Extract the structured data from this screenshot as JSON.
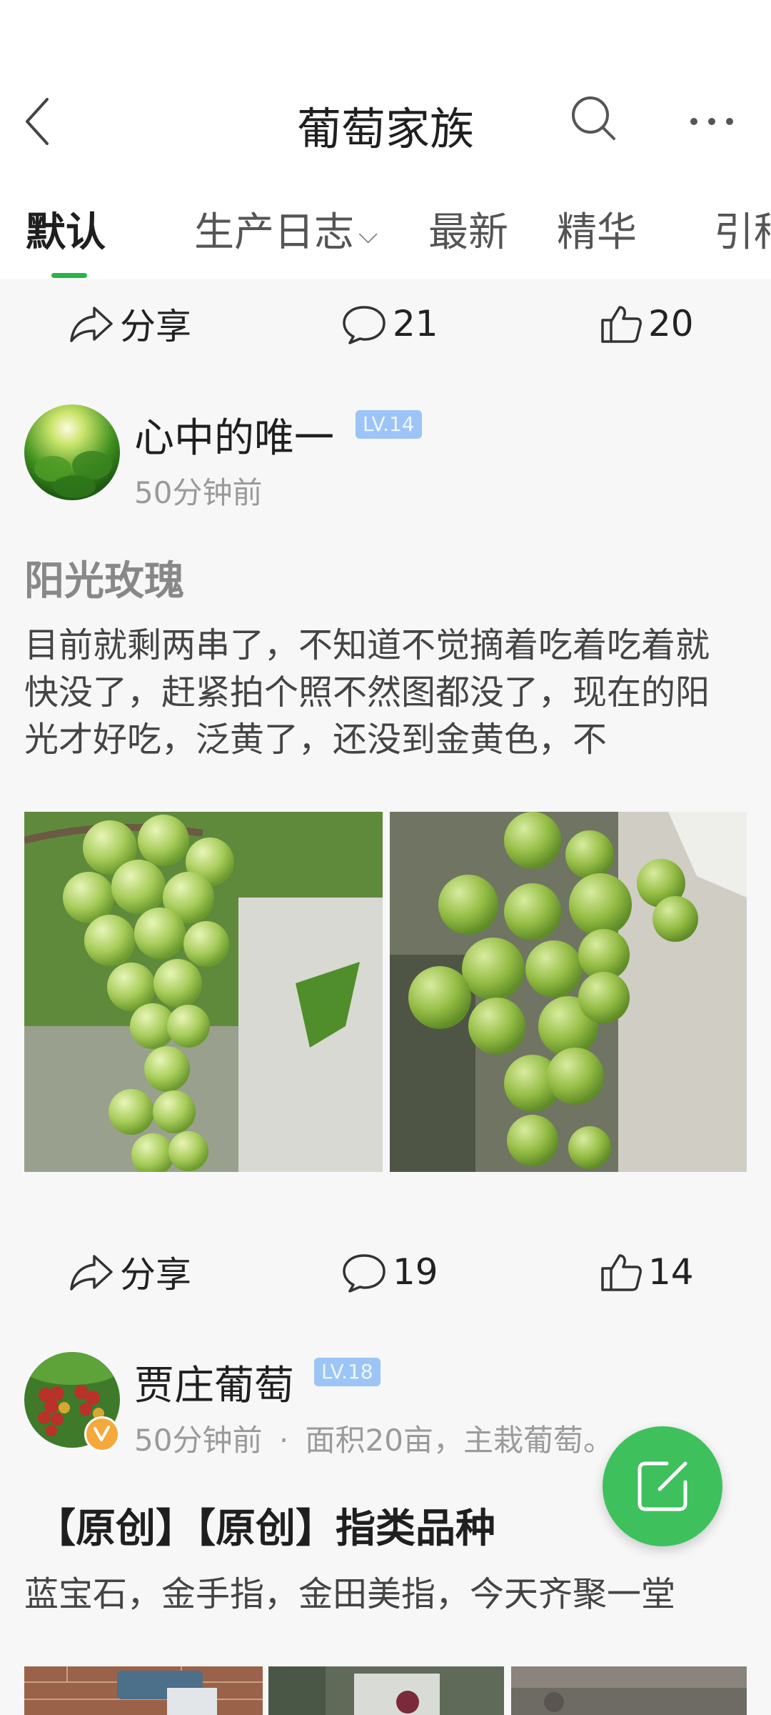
{
  "header": {
    "title": "葡萄家族"
  },
  "tabs": [
    {
      "label": "默认"
    },
    {
      "label": "生产日志"
    },
    {
      "label": "最新"
    },
    {
      "label": "精华"
    },
    {
      "label": "引种"
    }
  ],
  "top_actions": {
    "share": "分享",
    "comments": "21",
    "likes": "20"
  },
  "posts": [
    {
      "user": "心中的唯一",
      "level": "LV.14",
      "time": "50分钟前",
      "title": "阳光玫瑰",
      "body": "目前就剩两串了，不知道不觉摘着吃着吃着就快没了，赶紧拍个照不然图都没了，现在的阳光才好吃，泛黄了，还没到金黄色，不",
      "actions": {
        "share": "分享",
        "comments": "19",
        "likes": "14"
      }
    },
    {
      "user": "贾庄葡萄",
      "level": "LV.18",
      "time": "50分钟前",
      "meta_separator": "·",
      "meta_extra": "面积20亩，主栽葡萄。",
      "title": "【原创】【原创】指类品种",
      "body": "蓝宝石，金手指，金田美指，今天齐聚一堂"
    }
  ],
  "icons": [
    "back-arrow-icon",
    "search-icon",
    "more-icon",
    "share-icon",
    "comment-icon",
    "like-icon",
    "verified-icon",
    "compose-icon"
  ],
  "colors": {
    "accent": "#29b34a",
    "fab": "#3ec15d",
    "level_badge": "#9cc4f6"
  }
}
